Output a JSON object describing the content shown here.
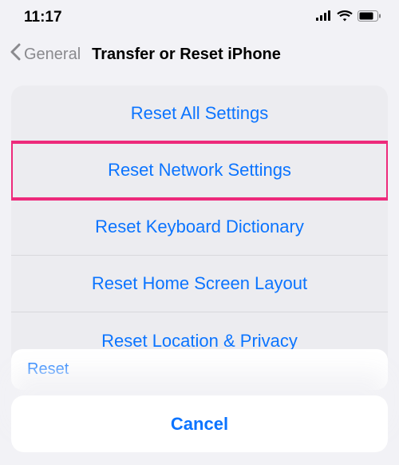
{
  "status_bar": {
    "time": "11:17"
  },
  "nav": {
    "back_label": "General",
    "title": "Transfer or Reset iPhone"
  },
  "action_sheet": {
    "items": [
      {
        "label": "Reset All Settings",
        "highlighted": false
      },
      {
        "label": "Reset Network Settings",
        "highlighted": true
      },
      {
        "label": "Reset Keyboard Dictionary",
        "highlighted": false
      },
      {
        "label": "Reset Home Screen Layout",
        "highlighted": false
      },
      {
        "label": "Reset Location & Privacy",
        "highlighted": false
      }
    ],
    "cancel_label": "Cancel"
  },
  "underlying": {
    "partial_label": "Reset"
  },
  "colors": {
    "ios_blue": "#0b74ff",
    "highlight_pink": "#ed2a7b",
    "gray_bg": "#f2f2f6"
  }
}
